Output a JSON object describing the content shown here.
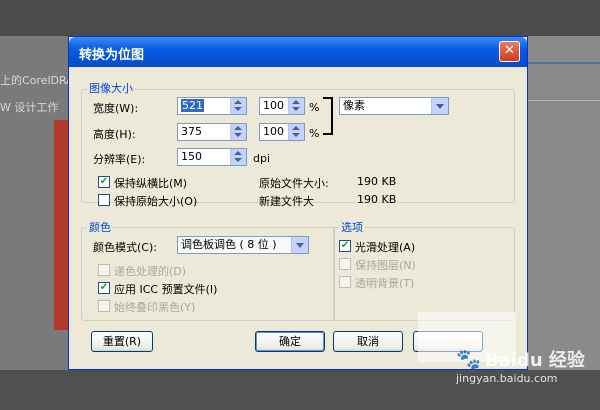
{
  "background": {
    "left_text_1": "上的CorelDRA",
    "left_text_2": "W 设计工作",
    "watermark_title": "Baidu 经验",
    "watermark_url": "jingyan.baidu.com"
  },
  "dialog": {
    "title": "转换为位图",
    "close_label": "✕",
    "image_size": {
      "group_title": "图像大小",
      "width_label": "宽度(W):",
      "width_value": "521",
      "width_percent": "100",
      "height_label": "高度(H):",
      "height_value": "375",
      "height_percent": "100",
      "percent_sign": "%",
      "unit_selected": "像素",
      "resolution_label": "分辨率(E):",
      "resolution_value": "150",
      "resolution_unit": "dpi",
      "keep_ratio_label": "保持纵横比(M)",
      "keep_ratio_checked": true,
      "keep_original_label": "保持原始大小(O)",
      "keep_original_checked": false,
      "original_size_label": "原始文件大小:",
      "original_size_value": "190 KB",
      "new_size_label": "新建文件大",
      "new_size_value": "190 KB"
    },
    "color": {
      "group_title": "颜色",
      "mode_label": "颜色模式(C):",
      "mode_selected": "调色板调色 ( 8 位 )",
      "dither_label": "递色处理的(D)",
      "icc_label": "应用 ICC 预置文件(I)",
      "icc_checked": true,
      "overprint_label": "始终叠印黑色(Y)"
    },
    "options": {
      "group_title": "选项",
      "smooth_label": "光滑处理(A)",
      "smooth_checked": true,
      "keep_layers_label": "保持图层(N)",
      "transparent_bg_label": "透明背景(T)"
    },
    "buttons": {
      "reset": "重置(R)",
      "ok": "确定",
      "cancel": "取消"
    }
  }
}
